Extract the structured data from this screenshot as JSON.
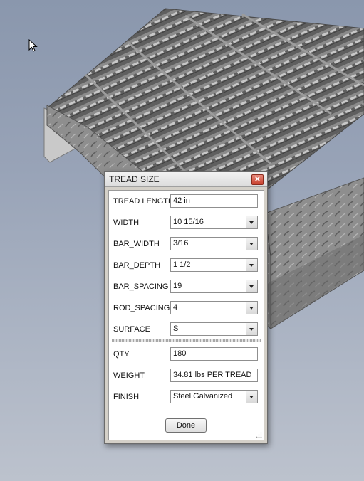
{
  "dialog": {
    "title": "TREAD SIZE",
    "close_icon": "close-icon",
    "fields": {
      "tread_length": {
        "label": "TREAD LENGTH",
        "value": "42 in"
      },
      "width": {
        "label": "WIDTH",
        "value": "10 15/16"
      },
      "bar_width": {
        "label": "BAR_WIDTH",
        "value": "3/16"
      },
      "bar_depth": {
        "label": "BAR_DEPTH",
        "value": "1 1/2"
      },
      "bar_spacing": {
        "label": "BAR_SPACING",
        "value": "19"
      },
      "rod_spacing": {
        "label": "ROD_SPACING",
        "value": "4"
      },
      "surface": {
        "label": "SURFACE",
        "value": "S"
      },
      "qty": {
        "label": "QTY",
        "value": "180"
      },
      "weight": {
        "label": "WEIGHT",
        "value": "34.81 lbs PER TREAD"
      },
      "finish": {
        "label": "FINISH",
        "value": "Steel Galvanized"
      }
    },
    "done_label": "Done"
  },
  "colors": {
    "background_top": "#8a97ad",
    "background_bottom": "#bcc2cd",
    "grating_steel": "#808080",
    "dialog_face": "#d4d0c8",
    "close_red": "#c8402c"
  }
}
